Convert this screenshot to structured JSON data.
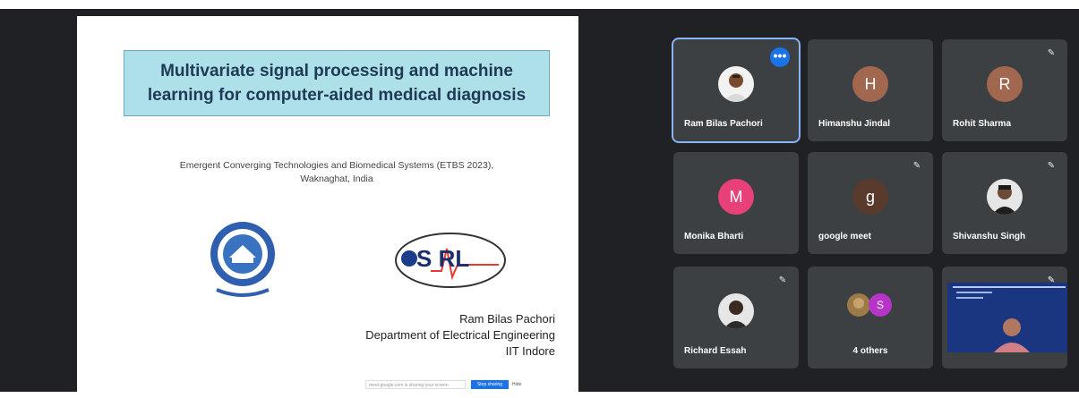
{
  "slide": {
    "title": "Multivariate signal processing and machine learning for computer-aided medical diagnosis",
    "conference_line1": "Emergent Converging Technologies and Biomedical Systems (ETBS 2023),",
    "conference_line2": "Waknaghat, India",
    "srl_logo_text": "S RL",
    "presenter_name": "Ram Bilas Pachori",
    "presenter_dept": "Department of Electrical Engineering",
    "presenter_inst": "IIT Indore",
    "toolbar": {
      "share_text": "meet.google.com is sharing your screen",
      "stop_label": "Stop sharing",
      "hide_label": "Hide"
    }
  },
  "participants": [
    {
      "name": "Ram Bilas Pachori",
      "avatar": "photo",
      "active": true,
      "menu": "•••"
    },
    {
      "name": "Himanshu Jindal",
      "avatar": "letter",
      "letter": "H",
      "color": "#a1674f"
    },
    {
      "name": "Rohit Sharma",
      "avatar": "letter",
      "letter": "R",
      "color": "#a1674f",
      "muted": true
    },
    {
      "name": "Monika Bharti",
      "avatar": "letter",
      "letter": "M",
      "color": "#e8417a"
    },
    {
      "name": "google meet",
      "avatar": "letter",
      "letter": "g",
      "color": "#5a3a2c",
      "muted": true
    },
    {
      "name": "Shivanshu Singh",
      "avatar": "photo",
      "muted": true
    },
    {
      "name": "Richard Essah",
      "avatar": "photo",
      "muted": true
    },
    {
      "name": "4 others",
      "avatar": "group",
      "letter": "S",
      "color": "#b634c8"
    },
    {
      "name": "",
      "avatar": "video",
      "muted": true
    }
  ],
  "colors": {
    "background": "#202124",
    "tile": "#3c4043",
    "accent": "#1a73e8",
    "active_outline": "#8ab4f8",
    "title_box": "#aee0ea"
  }
}
